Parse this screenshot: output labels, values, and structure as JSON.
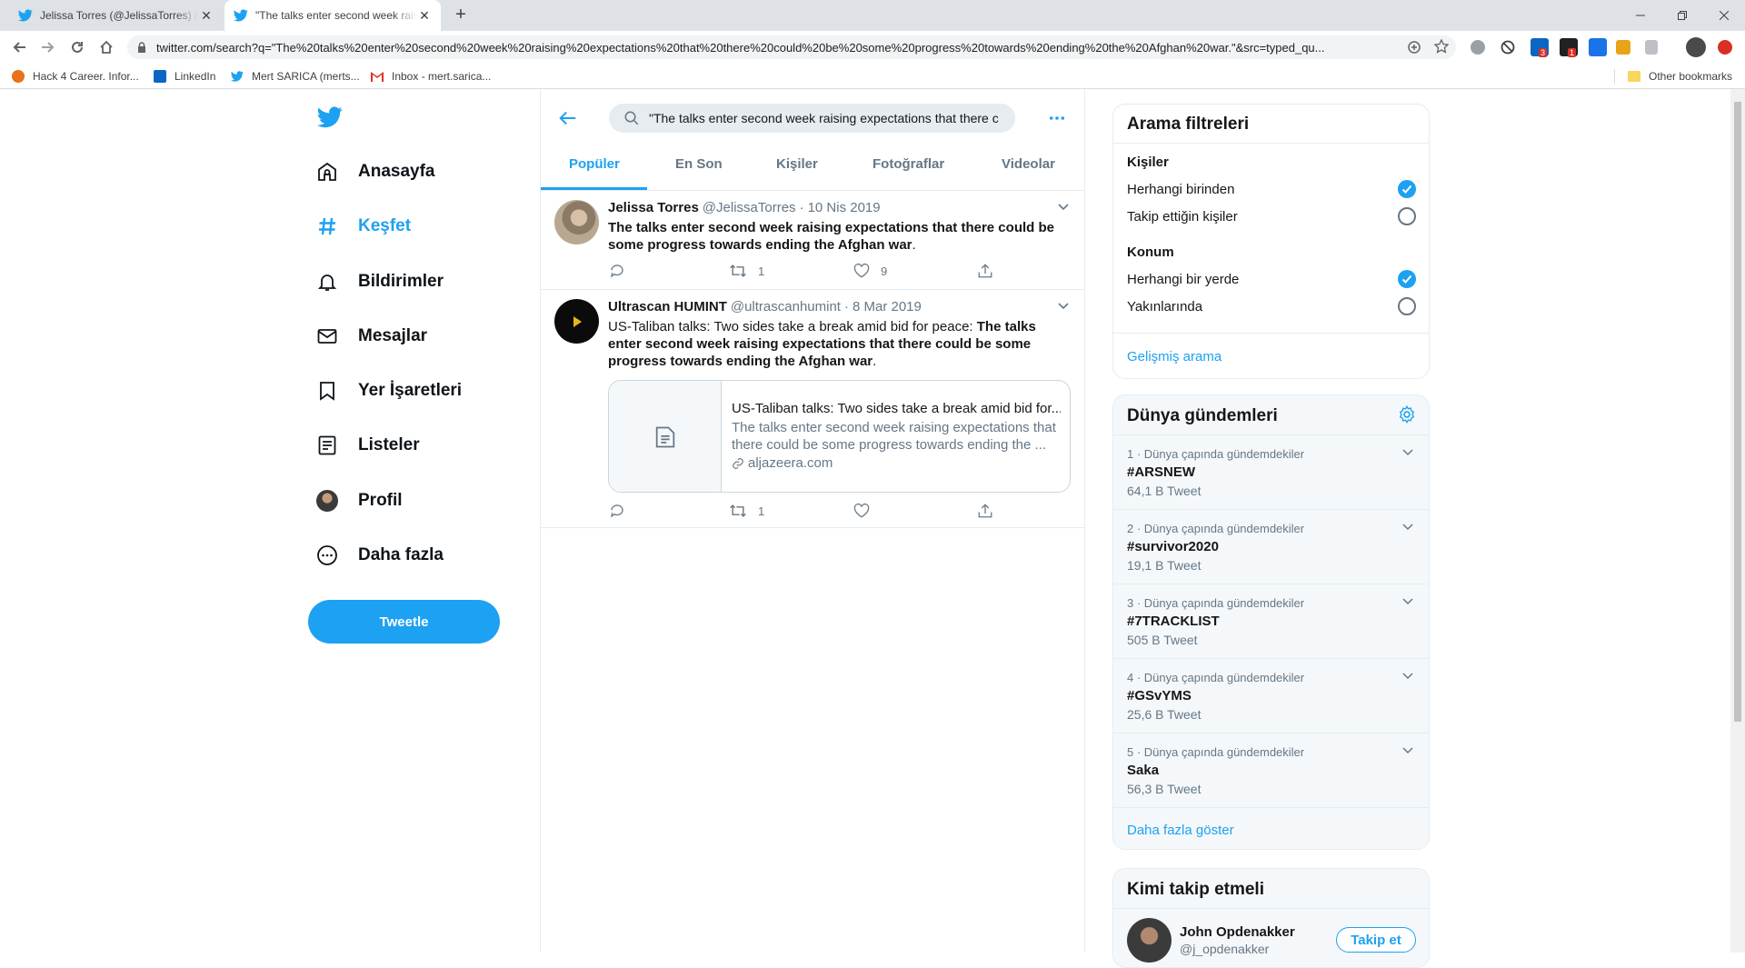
{
  "browser": {
    "tabs": [
      {
        "title": "Jelissa Torres (@JelissaTorres) / Twitter"
      },
      {
        "title": "\"The talks enter second week raising expectations\" - Twitter Search"
      }
    ],
    "url": "twitter.com/search?q=\"The%20talks%20enter%20second%20week%20raising%20expectations%20that%20there%20could%20be%20some%20progress%20towards%20ending%20the%20Afghan%20war.\"&src=typed_qu...",
    "bookmarks": [
      "Hack 4 Career. Infor...",
      "LinkedIn",
      "Mert SARICA (merts...",
      "Inbox - mert.sarica..."
    ],
    "other_bookmarks": "Other bookmarks",
    "extension_badges": {
      "linkedin": "3",
      "mail": "1"
    }
  },
  "nav": {
    "items": [
      {
        "label": "Anasayfa",
        "icon": "home-icon"
      },
      {
        "label": "Keşfet",
        "icon": "hashtag-icon"
      },
      {
        "label": "Bildirimler",
        "icon": "bell-icon"
      },
      {
        "label": "Mesajlar",
        "icon": "mail-icon"
      },
      {
        "label": "Yer İşaretleri",
        "icon": "bookmark-icon"
      },
      {
        "label": "Listeler",
        "icon": "list-icon"
      },
      {
        "label": "Profil",
        "icon": "avatar-icon"
      },
      {
        "label": "Daha fazla",
        "icon": "more-circle-icon"
      }
    ],
    "tweet_button": "Tweetle"
  },
  "search": {
    "query": "\"The talks enter second week raising expectations that there could be some progress towards ending the Afghan war.\"",
    "tabs": [
      "Popüler",
      "En Son",
      "Kişiler",
      "Fotoğraflar",
      "Videolar"
    ],
    "active_tab": "Popüler"
  },
  "tweets": [
    {
      "name": "Jelissa Torres",
      "handle": "@JelissaTorres",
      "date": "10 Nis 2019",
      "text_bold": "The talks enter second week raising expectations that there could be some progress towards ending the Afghan war",
      "text_tail": ".",
      "retweets": "1",
      "likes": "9"
    },
    {
      "name": "Ultrascan HUMINT",
      "handle": "@ultrascanhumint",
      "date": "8 Mar 2019",
      "text_plain": "US-Taliban talks: Two sides take a break amid bid for peace: ",
      "text_bold": "The talks enter second week raising expectations that there could be some progress towards ending the Afghan war",
      "text_tail": ".",
      "card": {
        "title": "US-Taliban talks: Two sides take a break amid bid for...",
        "description": "The talks enter second week raising expectations that there could be some progress towards ending the ...",
        "domain": "aljazeera.com"
      },
      "retweets": "1",
      "likes": ""
    }
  ],
  "filters": {
    "title": "Arama filtreleri",
    "people_section": "Kişiler",
    "people_options": [
      {
        "label": "Herhangi birinden",
        "checked": true
      },
      {
        "label": "Takip ettiğin kişiler",
        "checked": false
      }
    ],
    "location_section": "Konum",
    "location_options": [
      {
        "label": "Herhangi bir yerde",
        "checked": true
      },
      {
        "label": "Yakınlarında",
        "checked": false
      }
    ],
    "advanced": "Gelişmiş arama"
  },
  "trends": {
    "title": "Dünya gündemleri",
    "items": [
      {
        "meta": "1 · Dünya çapında gündemdekiler",
        "name": "#ARSNEW",
        "count": "64,1 B Tweet"
      },
      {
        "meta": "2 · Dünya çapında gündemdekiler",
        "name": "#survivor2020",
        "count": "19,1 B Tweet"
      },
      {
        "meta": "3 · Dünya çapında gündemdekiler",
        "name": "#7TRACKLIST",
        "count": "505 B Tweet"
      },
      {
        "meta": "4 · Dünya çapında gündemdekiler",
        "name": "#GSvYMS",
        "count": "25,6 B Tweet"
      },
      {
        "meta": "5 · Dünya çapında gündemdekiler",
        "name": "Saka",
        "count": "56,3 B Tweet"
      }
    ],
    "show_more": "Daha fazla göster"
  },
  "who_to_follow": {
    "title": "Kimi takip etmeli",
    "user": {
      "name": "John Opdenakker",
      "handle": "@j_opdenakker"
    },
    "follow_label": "Takip et"
  },
  "colors": {
    "accent": "#1da1f2",
    "text": "#14171a",
    "muted": "#657786",
    "border": "#e6ecf0"
  }
}
